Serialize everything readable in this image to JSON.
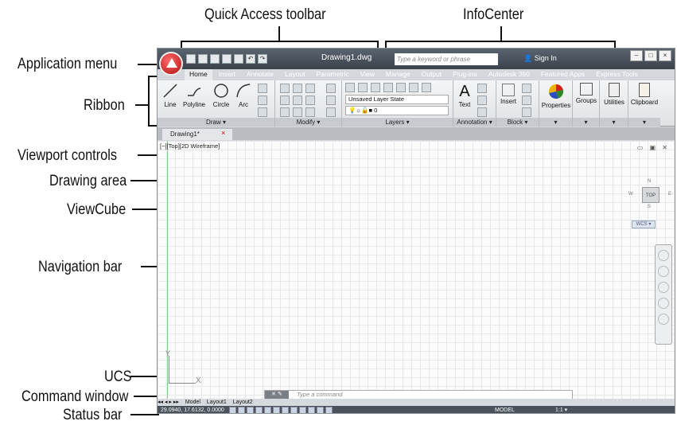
{
  "callouts": {
    "quick_access": "Quick Access toolbar",
    "infocenter": "InfoCenter",
    "app_menu": "Application menu",
    "ribbon": "Ribbon",
    "viewport_controls": "Viewport controls",
    "drawing_area": "Drawing area",
    "viewcube": "ViewCube",
    "navigation_bar": "Navigation bar",
    "ucs": "UCS",
    "command_window": "Command window",
    "status_bar": "Status bar"
  },
  "titlebar": {
    "document": "Drawing1.dwg",
    "search_placeholder": "Type a keyword or phrase",
    "signin": "Sign In"
  },
  "tabs": [
    "Home",
    "Insert",
    "Annotate",
    "Layout",
    "Parametric",
    "View",
    "Manage",
    "Output",
    "Plug-ins",
    "Autodesk 360",
    "Featured Apps",
    "Express Tools"
  ],
  "active_tab": "Home",
  "ribbon": {
    "draw_tools": [
      "Line",
      "Polyline",
      "Circle",
      "Arc"
    ],
    "panels": {
      "draw": "Draw ▾",
      "modify": "Modify ▾",
      "layers": "Layers ▾",
      "annotation": "Annotation ▾",
      "block": "Block ▾"
    },
    "layer_state": "Unsaved Layer State",
    "layer_current": "0",
    "text_tool": "Text",
    "insert_tool": "Insert",
    "properties": "Properties",
    "groups": "Groups",
    "utilities": "Utilities",
    "clipboard": "Clipboard"
  },
  "doc_tab": "Drawing1*",
  "viewport_controls": "[−][Top][2D Wireframe]",
  "viewcube": {
    "face": "TOP",
    "north": "N",
    "south": "S",
    "east": "E",
    "west": "W",
    "wcs": "WCS ▾"
  },
  "ucs": {
    "x": "X",
    "y": "Y"
  },
  "command": {
    "placeholder": "Type a command"
  },
  "layout_tabs": [
    "Model",
    "Layout1",
    "Layout2"
  ],
  "status": {
    "coords": "29.0940, 17.6132, 0.0000",
    "model": "MODEL",
    "scale": "1:1 ▾"
  }
}
